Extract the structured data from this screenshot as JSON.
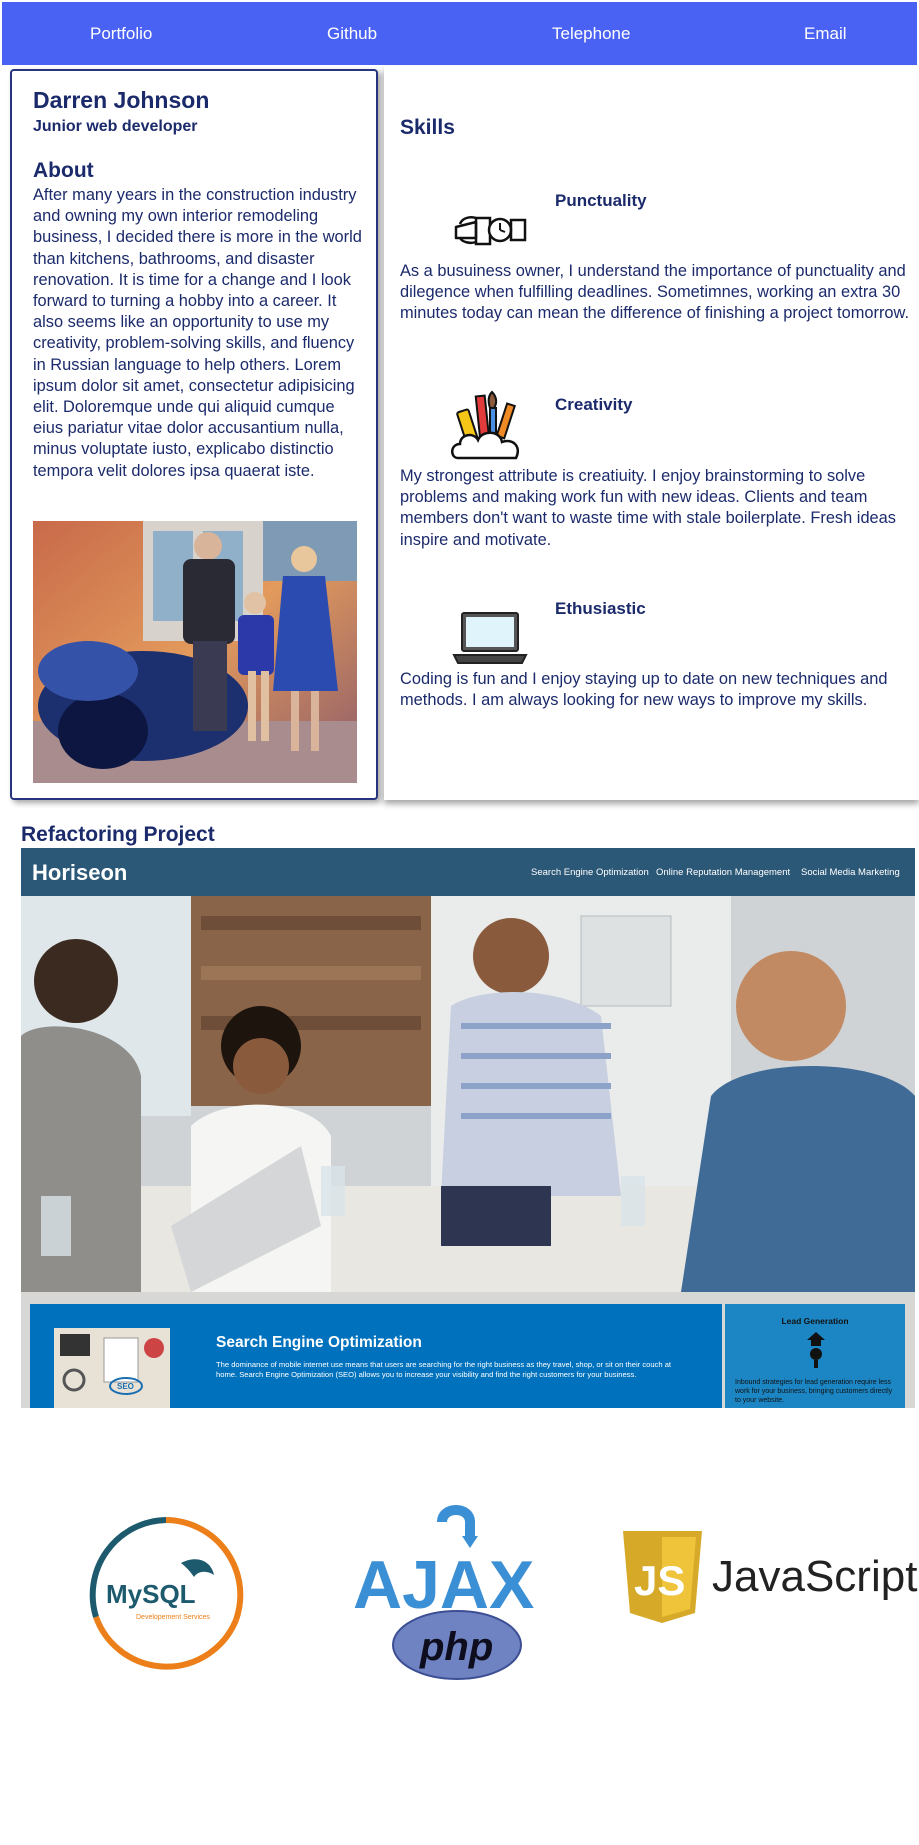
{
  "nav": {
    "items": [
      "Portfolio",
      "Github",
      "Telephone",
      "Email"
    ]
  },
  "profile": {
    "name": "Darren Johnson",
    "role": "Junior web developer",
    "about_heading": "About",
    "about_text": "After many years in the construction industry and owning my own interior remodeling business, I decided there is more in the world than kitchens, bathrooms, and disaster renovation. It is time for a change and I look forward to turning a hobby into a career. It also seems like an opportunity to use my creativity, problem-solving skills, and fluency in Russian language to help others. Lorem ipsum dolor sit amet, consectetur adipisicing elit. Doloremque unde qui aliquid cumque eius pariatur vitae dolor accusantium nulla, minus voluptate iusto, explicabo distinctio tempora velit dolores ipsa quaerat iste."
  },
  "skills": {
    "heading": "Skills",
    "items": [
      {
        "title": "Punctuality",
        "icon": "watch-icon",
        "text": "As a busuiness owner, I understand the importance of punctuality and dilegence when fulfilling deadlines. Sometimnes, working an extra 30 minutes today can mean the difference of finishing a project tomorrow."
      },
      {
        "title": "Creativity",
        "icon": "paintbrush-cloud-icon",
        "text": "My strongest attribute is creatiuity. I enjoy brainstorming to solve problems and making work fun with new ideas. Clients and team members don't want to waste time with stale boilerplate. Fresh ideas inspire and motivate."
      },
      {
        "title": "Ethusiastic",
        "icon": "laptop-icon",
        "text": "Coding is fun and I enjoy staying up to date on new techniques and methods. I am always looking for new ways to improve my skills."
      }
    ]
  },
  "project": {
    "heading": "Refactoring Project",
    "screenshot": {
      "logo": "Horiseon",
      "nav": [
        "Search Engine Optimization",
        "Online Reputation Management",
        "Social Media Marketing"
      ],
      "seo_title": "Search Engine Optimization",
      "seo_text": "The dominance of mobile internet use means that users are searching for the right business as they travel, shop, or sit on their couch at home. Search Engine Optimization (SEO) allows you to increase your visibility and find the right customers for your business.",
      "thumb_label": "SEO",
      "lead_title": "Lead Generation",
      "lead_text": "Inbound strategies for lead generation require less work for your business, bringing customers directly to your website."
    }
  },
  "logos": {
    "mysql": "MySQL",
    "mysql_sub": "Developement Services",
    "ajax": "AJAX",
    "php": "php",
    "js_badge": "JS",
    "js": "JavaScript"
  },
  "colors": {
    "nav_bg": "#4a62f3",
    "heading": "#1b2a6b",
    "horiseon_bar": "#2c5877",
    "seo_blue": "#0072bd"
  }
}
